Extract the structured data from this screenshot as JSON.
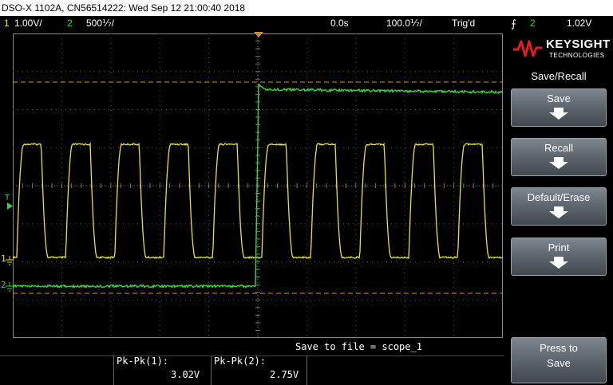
{
  "title_bar": "DSO-X 1102A, CN56514222: Wed Sep 12 21:00:40 2018",
  "status": {
    "ch1_num": "1",
    "ch1_scale": "1.00V/",
    "ch2_num": "2",
    "ch2_scale": "500⅐/",
    "time_delay": "0.0s",
    "time_scale": "100.0⅐/",
    "trigger_state": "Trig'd",
    "trigger_source": "2",
    "trigger_level": "1.02V",
    "colors": {
      "ch1": "#e8e23a",
      "ch2": "#3ad43a",
      "trigger": "#f08a1c"
    }
  },
  "screen_markers": {
    "trigger_marker": "T",
    "ch1_ground": "1",
    "ch2_ground": "2"
  },
  "panel": {
    "brand": "KEYSIGHT",
    "brand_sub": "TECHNOLOGIES",
    "menu_title": "Save/Recall",
    "softkeys": [
      {
        "label": "Save"
      },
      {
        "label": "Recall"
      },
      {
        "label": "Default/Erase"
      },
      {
        "label": "Print"
      }
    ],
    "press_to": "Press to",
    "press_save": "Save"
  },
  "bottom": {
    "save_to_file": "Save to file = scope_1",
    "meas1_label": "Pk-Pk(1):",
    "meas1_value": "3.02V",
    "meas2_label": "Pk-Pk(2):",
    "meas2_value": "2.75V"
  },
  "waveforms": {
    "ch1_period_us": 108,
    "ch1_pkpk_v": 3.02,
    "ch2_step_time_us": 0,
    "ch2_pkpk_v": 2.75
  }
}
